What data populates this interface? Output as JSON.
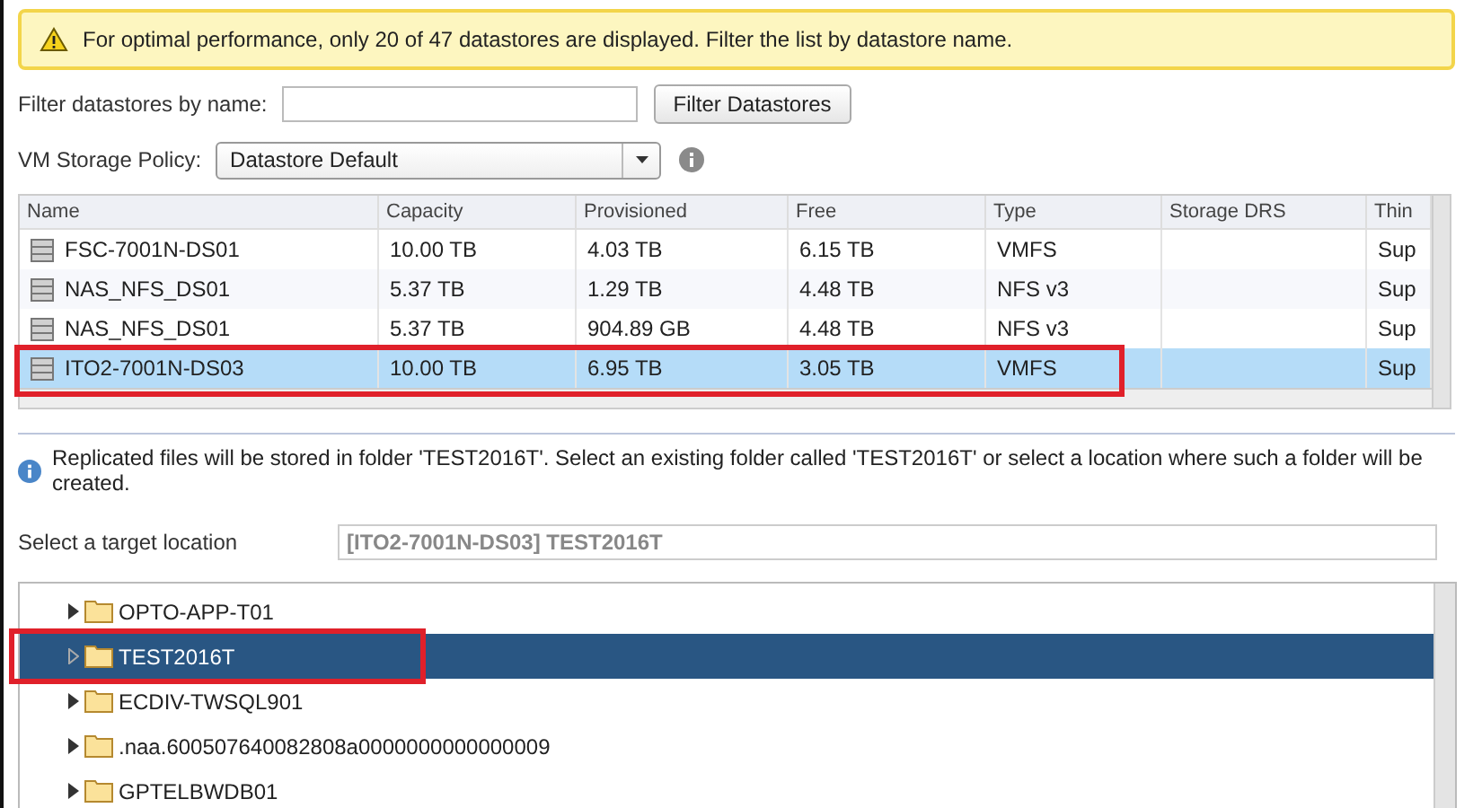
{
  "warning": "For optimal performance, only 20 of 47 datastores are displayed. Filter the list by datastore name.",
  "filter": {
    "label": "Filter datastores by name:",
    "button": "Filter Datastores"
  },
  "policy": {
    "label": "VM Storage Policy:",
    "value": "Datastore Default"
  },
  "table": {
    "columns": [
      "Name",
      "Capacity",
      "Provisioned",
      "Free",
      "Type",
      "Storage DRS",
      "Thin"
    ],
    "rows": [
      {
        "cells": [
          "FSC-7001N-DS01",
          "10.00 TB",
          "4.03 TB",
          "6.15 TB",
          "VMFS",
          "",
          "Sup"
        ],
        "selected": false,
        "annotated": false
      },
      {
        "cells": [
          "NAS_NFS_DS01",
          "5.37 TB",
          "1.29 TB",
          "4.48 TB",
          "NFS v3",
          "",
          "Sup"
        ],
        "selected": false,
        "annotated": false
      },
      {
        "cells": [
          "NAS_NFS_DS01",
          "5.37 TB",
          "904.89 GB",
          "4.48 TB",
          "NFS v3",
          "",
          "Sup"
        ],
        "selected": false,
        "annotated": false
      },
      {
        "cells": [
          "ITO2-7001N-DS03",
          "10.00 TB",
          "6.95 TB",
          "3.05 TB",
          "VMFS",
          "",
          "Sup"
        ],
        "selected": true,
        "annotated": true
      }
    ]
  },
  "info": "Replicated files will be stored in folder 'TEST2016T'. Select an existing folder called 'TEST2016T' or select a location where such a folder will be created.",
  "target": {
    "label": "Select a target location",
    "value": "[ITO2-7001N-DS03] TEST2016T"
  },
  "tree": [
    {
      "label": "OPTO-APP-T01",
      "selected": false,
      "annotated": false
    },
    {
      "label": "TEST2016T",
      "selected": true,
      "annotated": true
    },
    {
      "label": "ECDIV-TWSQL901",
      "selected": false,
      "annotated": false
    },
    {
      "label": ".naa.600507640082808a0000000000000009",
      "selected": false,
      "annotated": false
    },
    {
      "label": "GPTELBWDB01",
      "selected": false,
      "annotated": false
    }
  ]
}
